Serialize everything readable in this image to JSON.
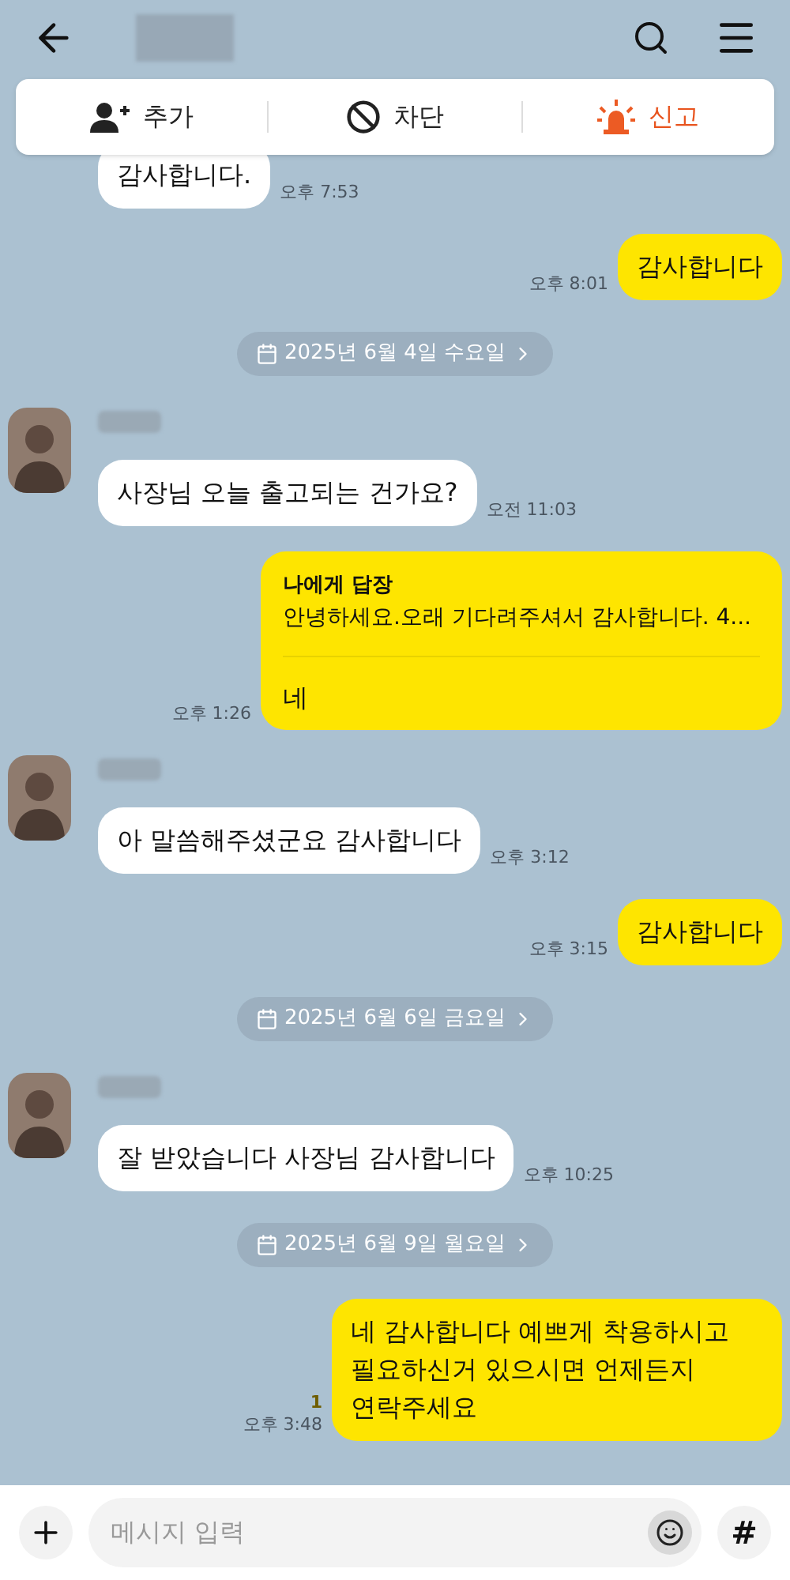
{
  "action_bar": [
    {
      "kind": "add",
      "label": "추가"
    },
    {
      "kind": "block",
      "label": "차단"
    },
    {
      "kind": "report",
      "label": "신고"
    }
  ],
  "messages": [
    {
      "kind": "received",
      "avatar": false,
      "text": "감사합니다.",
      "time": "오후 7:53"
    },
    {
      "kind": "sent",
      "text": "감사합니다",
      "time": "오후 8:01"
    },
    {
      "kind": "date",
      "text": "2025년 6월 4일 수요일"
    },
    {
      "kind": "received",
      "avatar": true,
      "text": "사장님 오늘 출고되는 건가요?",
      "time": "오전 11:03"
    },
    {
      "kind": "reply",
      "reply_title": "나에게 답장",
      "quote": "안녕하세요.오래 기다려주셔서 감사합니다. 4...",
      "text": "네",
      "time": "오후 1:26"
    },
    {
      "kind": "received",
      "avatar": true,
      "text": "아 말씀해주셨군요 감사합니다",
      "time": "오후 3:12"
    },
    {
      "kind": "sent",
      "text": "감사합니다",
      "time": "오후 3:15"
    },
    {
      "kind": "date",
      "text": "2025년 6월 6일 금요일"
    },
    {
      "kind": "received",
      "avatar": true,
      "text": "잘 받았습니다 사장님 감사합니다",
      "time": "오후 10:25"
    },
    {
      "kind": "date",
      "text": "2025년 6월 9일 월요일"
    },
    {
      "kind": "sent",
      "text": "네 감사합니다 예쁘게 착용하시고 필요하신거 있으시면 언제든지 연락주세요",
      "time": "오후 3:48",
      "unread": "1"
    }
  ],
  "input": {
    "placeholder": "메시지 입력"
  },
  "hash_button": "#"
}
